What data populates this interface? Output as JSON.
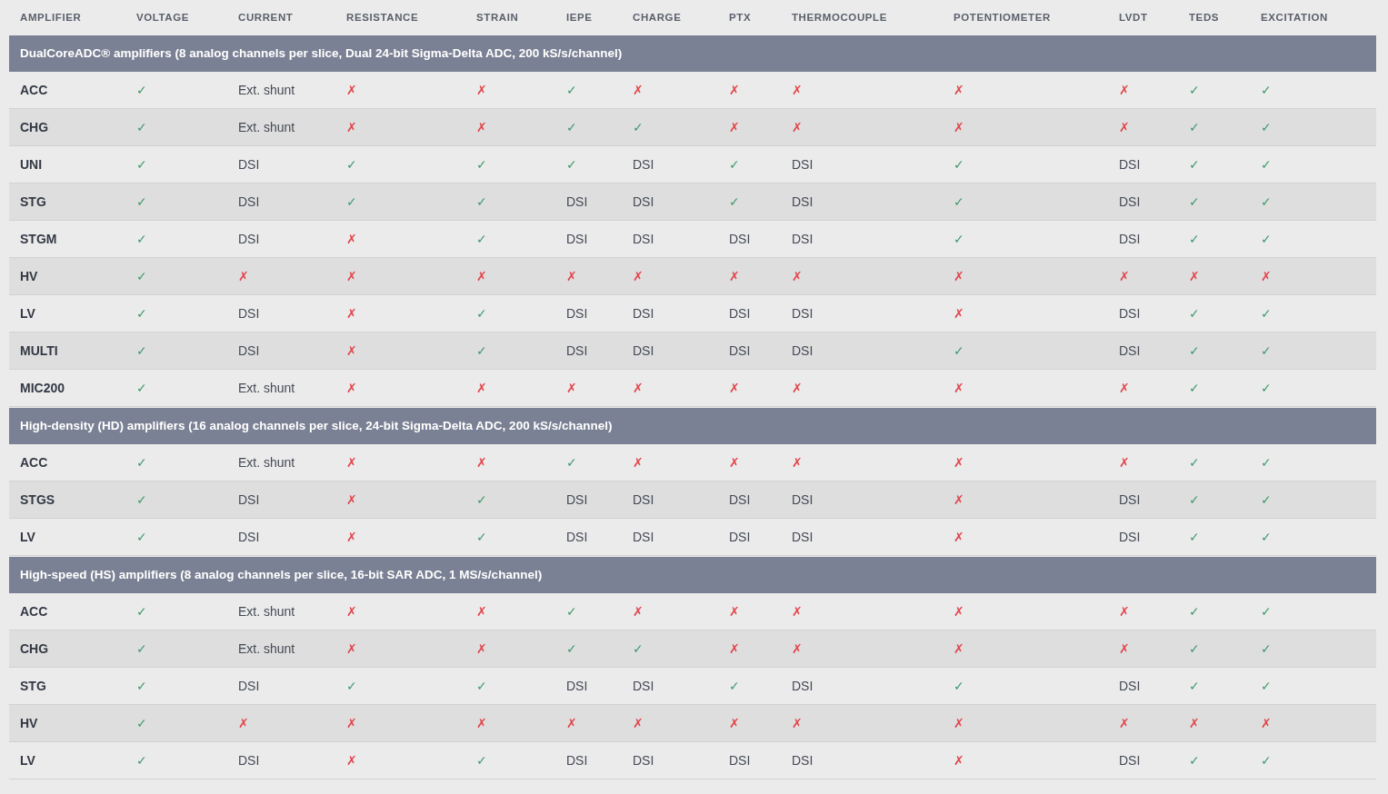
{
  "table": {
    "columns": [
      "AMPLIFIER",
      "VOLTAGE",
      "CURRENT",
      "RESISTANCE",
      "STRAIN",
      "IEPE",
      "CHARGE",
      "PTX",
      "THERMOCOUPLE",
      "POTENTIOMETER",
      "LVDT",
      "TEDS",
      "EXCITATION"
    ],
    "groups": [
      {
        "title": "DualCoreADC® amplifiers (8 analog channels per slice, Dual 24-bit Sigma-Delta ADC, 200 kS/s/channel)",
        "rows": [
          {
            "amplifier": "ACC",
            "cells": [
              {
                "text": "✓",
                "kind": "yes"
              },
              {
                "text": "Ext. shunt",
                "kind": "text"
              },
              {
                "text": "✗",
                "kind": "no"
              },
              {
                "text": "✗",
                "kind": "no"
              },
              {
                "text": "✓",
                "kind": "yes"
              },
              {
                "text": "✗",
                "kind": "no"
              },
              {
                "text": "✗",
                "kind": "no"
              },
              {
                "text": "✗",
                "kind": "no"
              },
              {
                "text": "✗",
                "kind": "no"
              },
              {
                "text": "✗",
                "kind": "no"
              },
              {
                "text": "✓",
                "kind": "yes"
              },
              {
                "text": "✓",
                "kind": "yes"
              }
            ]
          },
          {
            "amplifier": "CHG",
            "cells": [
              {
                "text": "✓",
                "kind": "yes"
              },
              {
                "text": "Ext. shunt",
                "kind": "text"
              },
              {
                "text": "✗",
                "kind": "no"
              },
              {
                "text": "✗",
                "kind": "no"
              },
              {
                "text": "✓",
                "kind": "yes"
              },
              {
                "text": "✓",
                "kind": "yes"
              },
              {
                "text": "✗",
                "kind": "no"
              },
              {
                "text": "✗",
                "kind": "no"
              },
              {
                "text": "✗",
                "kind": "no"
              },
              {
                "text": "✗",
                "kind": "no"
              },
              {
                "text": "✓",
                "kind": "yes"
              },
              {
                "text": "✓",
                "kind": "yes"
              }
            ]
          },
          {
            "amplifier": "UNI",
            "cells": [
              {
                "text": "✓",
                "kind": "yes"
              },
              {
                "text": "DSI",
                "kind": "text"
              },
              {
                "text": "✓",
                "kind": "yes"
              },
              {
                "text": "✓",
                "kind": "yes"
              },
              {
                "text": "✓",
                "kind": "yes"
              },
              {
                "text": "DSI",
                "kind": "text"
              },
              {
                "text": "✓",
                "kind": "yes"
              },
              {
                "text": "DSI",
                "kind": "text"
              },
              {
                "text": "✓",
                "kind": "yes"
              },
              {
                "text": "DSI",
                "kind": "text"
              },
              {
                "text": "✓",
                "kind": "yes"
              },
              {
                "text": "✓",
                "kind": "yes"
              }
            ]
          },
          {
            "amplifier": "STG",
            "cells": [
              {
                "text": "✓",
                "kind": "yes"
              },
              {
                "text": "DSI",
                "kind": "text"
              },
              {
                "text": "✓",
                "kind": "yes"
              },
              {
                "text": "✓",
                "kind": "yes"
              },
              {
                "text": "DSI",
                "kind": "text"
              },
              {
                "text": "DSI",
                "kind": "text"
              },
              {
                "text": "✓",
                "kind": "yes"
              },
              {
                "text": "DSI",
                "kind": "text"
              },
              {
                "text": "✓",
                "kind": "yes"
              },
              {
                "text": "DSI",
                "kind": "text"
              },
              {
                "text": "✓",
                "kind": "yes"
              },
              {
                "text": "✓",
                "kind": "yes"
              }
            ]
          },
          {
            "amplifier": "STGM",
            "cells": [
              {
                "text": "✓",
                "kind": "yes"
              },
              {
                "text": "DSI",
                "kind": "text"
              },
              {
                "text": "✗",
                "kind": "no"
              },
              {
                "text": "✓",
                "kind": "yes"
              },
              {
                "text": "DSI",
                "kind": "text"
              },
              {
                "text": "DSI",
                "kind": "text"
              },
              {
                "text": "DSI",
                "kind": "text"
              },
              {
                "text": "DSI",
                "kind": "text"
              },
              {
                "text": "✓",
                "kind": "yes"
              },
              {
                "text": "DSI",
                "kind": "text"
              },
              {
                "text": "✓",
                "kind": "yes"
              },
              {
                "text": "✓",
                "kind": "yes"
              }
            ]
          },
          {
            "amplifier": "HV",
            "cells": [
              {
                "text": "✓",
                "kind": "yes"
              },
              {
                "text": "✗",
                "kind": "no"
              },
              {
                "text": "✗",
                "kind": "no"
              },
              {
                "text": "✗",
                "kind": "no"
              },
              {
                "text": "✗",
                "kind": "no"
              },
              {
                "text": "✗",
                "kind": "no"
              },
              {
                "text": "✗",
                "kind": "no"
              },
              {
                "text": "✗",
                "kind": "no"
              },
              {
                "text": "✗",
                "kind": "no"
              },
              {
                "text": "✗",
                "kind": "no"
              },
              {
                "text": "✗",
                "kind": "no"
              },
              {
                "text": "✗",
                "kind": "no"
              }
            ]
          },
          {
            "amplifier": "LV",
            "cells": [
              {
                "text": "✓",
                "kind": "yes"
              },
              {
                "text": "DSI",
                "kind": "text"
              },
              {
                "text": "✗",
                "kind": "no"
              },
              {
                "text": "✓",
                "kind": "yes"
              },
              {
                "text": "DSI",
                "kind": "text"
              },
              {
                "text": "DSI",
                "kind": "text"
              },
              {
                "text": "DSI",
                "kind": "text"
              },
              {
                "text": "DSI",
                "kind": "text"
              },
              {
                "text": "✗",
                "kind": "no"
              },
              {
                "text": "DSI",
                "kind": "text"
              },
              {
                "text": "✓",
                "kind": "yes"
              },
              {
                "text": "✓",
                "kind": "yes"
              }
            ]
          },
          {
            "amplifier": "MULTI",
            "cells": [
              {
                "text": "✓",
                "kind": "yes"
              },
              {
                "text": "DSI",
                "kind": "text"
              },
              {
                "text": "✗",
                "kind": "no"
              },
              {
                "text": "✓",
                "kind": "yes"
              },
              {
                "text": "DSI",
                "kind": "text"
              },
              {
                "text": "DSI",
                "kind": "text"
              },
              {
                "text": "DSI",
                "kind": "text"
              },
              {
                "text": "DSI",
                "kind": "text"
              },
              {
                "text": "✓",
                "kind": "yes"
              },
              {
                "text": "DSI",
                "kind": "text"
              },
              {
                "text": "✓",
                "kind": "yes"
              },
              {
                "text": "✓",
                "kind": "yes"
              }
            ]
          },
          {
            "amplifier": "MIC200",
            "cells": [
              {
                "text": "✓",
                "kind": "yes"
              },
              {
                "text": "Ext. shunt",
                "kind": "text"
              },
              {
                "text": "✗",
                "kind": "no"
              },
              {
                "text": "✗",
                "kind": "no"
              },
              {
                "text": "✗",
                "kind": "no"
              },
              {
                "text": "✗",
                "kind": "no"
              },
              {
                "text": "✗",
                "kind": "no"
              },
              {
                "text": "✗",
                "kind": "no"
              },
              {
                "text": "✗",
                "kind": "no"
              },
              {
                "text": "✗",
                "kind": "no"
              },
              {
                "text": "✓",
                "kind": "yes"
              },
              {
                "text": "✓",
                "kind": "yes"
              }
            ]
          }
        ]
      },
      {
        "title": "High-density (HD) amplifiers (16 analog channels per slice, 24-bit Sigma-Delta ADC, 200 kS/s/channel)",
        "rows": [
          {
            "amplifier": "ACC",
            "cells": [
              {
                "text": "✓",
                "kind": "yes"
              },
              {
                "text": "Ext. shunt",
                "kind": "text"
              },
              {
                "text": "✗",
                "kind": "no"
              },
              {
                "text": "✗",
                "kind": "no"
              },
              {
                "text": "✓",
                "kind": "yes"
              },
              {
                "text": "✗",
                "kind": "no"
              },
              {
                "text": "✗",
                "kind": "no"
              },
              {
                "text": "✗",
                "kind": "no"
              },
              {
                "text": "✗",
                "kind": "no"
              },
              {
                "text": "✗",
                "kind": "no"
              },
              {
                "text": "✓",
                "kind": "yes"
              },
              {
                "text": "✓",
                "kind": "yes"
              }
            ]
          },
          {
            "amplifier": "STGS",
            "cells": [
              {
                "text": "✓",
                "kind": "yes"
              },
              {
                "text": "DSI",
                "kind": "text"
              },
              {
                "text": "✗",
                "kind": "no"
              },
              {
                "text": "✓",
                "kind": "yes"
              },
              {
                "text": "DSI",
                "kind": "text"
              },
              {
                "text": "DSI",
                "kind": "text"
              },
              {
                "text": "DSI",
                "kind": "text"
              },
              {
                "text": "DSI",
                "kind": "text"
              },
              {
                "text": "✗",
                "kind": "no"
              },
              {
                "text": "DSI",
                "kind": "text"
              },
              {
                "text": "✓",
                "kind": "yes"
              },
              {
                "text": "✓",
                "kind": "yes"
              }
            ]
          },
          {
            "amplifier": "LV",
            "cells": [
              {
                "text": "✓",
                "kind": "yes"
              },
              {
                "text": "DSI",
                "kind": "text"
              },
              {
                "text": "✗",
                "kind": "no"
              },
              {
                "text": "✓",
                "kind": "yes"
              },
              {
                "text": "DSI",
                "kind": "text"
              },
              {
                "text": "DSI",
                "kind": "text"
              },
              {
                "text": "DSI",
                "kind": "text"
              },
              {
                "text": "DSI",
                "kind": "text"
              },
              {
                "text": "✗",
                "kind": "no"
              },
              {
                "text": "DSI",
                "kind": "text"
              },
              {
                "text": "✓",
                "kind": "yes"
              },
              {
                "text": "✓",
                "kind": "yes"
              }
            ]
          }
        ]
      },
      {
        "title": "High-speed (HS) amplifiers (8 analog channels per slice, 16-bit SAR ADC, 1 MS/s/channel)",
        "rows": [
          {
            "amplifier": "ACC",
            "cells": [
              {
                "text": "✓",
                "kind": "yes"
              },
              {
                "text": "Ext. shunt",
                "kind": "text"
              },
              {
                "text": "✗",
                "kind": "no"
              },
              {
                "text": "✗",
                "kind": "no"
              },
              {
                "text": "✓",
                "kind": "yes"
              },
              {
                "text": "✗",
                "kind": "no"
              },
              {
                "text": "✗",
                "kind": "no"
              },
              {
                "text": "✗",
                "kind": "no"
              },
              {
                "text": "✗",
                "kind": "no"
              },
              {
                "text": "✗",
                "kind": "no"
              },
              {
                "text": "✓",
                "kind": "yes"
              },
              {
                "text": "✓",
                "kind": "yes"
              }
            ]
          },
          {
            "amplifier": "CHG",
            "cells": [
              {
                "text": "✓",
                "kind": "yes"
              },
              {
                "text": "Ext. shunt",
                "kind": "text"
              },
              {
                "text": "✗",
                "kind": "no"
              },
              {
                "text": "✗",
                "kind": "no"
              },
              {
                "text": "✓",
                "kind": "yes"
              },
              {
                "text": "✓",
                "kind": "yes"
              },
              {
                "text": "✗",
                "kind": "no"
              },
              {
                "text": "✗",
                "kind": "no"
              },
              {
                "text": "✗",
                "kind": "no"
              },
              {
                "text": "✗",
                "kind": "no"
              },
              {
                "text": "✓",
                "kind": "yes"
              },
              {
                "text": "✓",
                "kind": "yes"
              }
            ]
          },
          {
            "amplifier": "STG",
            "cells": [
              {
                "text": "✓",
                "kind": "yes"
              },
              {
                "text": "DSI",
                "kind": "text"
              },
              {
                "text": "✓",
                "kind": "yes"
              },
              {
                "text": "✓",
                "kind": "yes"
              },
              {
                "text": "DSI",
                "kind": "text"
              },
              {
                "text": "DSI",
                "kind": "text"
              },
              {
                "text": "✓",
                "kind": "yes"
              },
              {
                "text": "DSI",
                "kind": "text"
              },
              {
                "text": "✓",
                "kind": "yes"
              },
              {
                "text": "DSI",
                "kind": "text"
              },
              {
                "text": "✓",
                "kind": "yes"
              },
              {
                "text": "✓",
                "kind": "yes"
              }
            ]
          },
          {
            "amplifier": "HV",
            "cells": [
              {
                "text": "✓",
                "kind": "yes"
              },
              {
                "text": "✗",
                "kind": "no"
              },
              {
                "text": "✗",
                "kind": "no"
              },
              {
                "text": "✗",
                "kind": "no"
              },
              {
                "text": "✗",
                "kind": "no"
              },
              {
                "text": "✗",
                "kind": "no"
              },
              {
                "text": "✗",
                "kind": "no"
              },
              {
                "text": "✗",
                "kind": "no"
              },
              {
                "text": "✗",
                "kind": "no"
              },
              {
                "text": "✗",
                "kind": "no"
              },
              {
                "text": "✗",
                "kind": "no"
              },
              {
                "text": "✗",
                "kind": "no"
              }
            ]
          },
          {
            "amplifier": "LV",
            "cells": [
              {
                "text": "✓",
                "kind": "yes"
              },
              {
                "text": "DSI",
                "kind": "text"
              },
              {
                "text": "✗",
                "kind": "no"
              },
              {
                "text": "✓",
                "kind": "yes"
              },
              {
                "text": "DSI",
                "kind": "text"
              },
              {
                "text": "DSI",
                "kind": "text"
              },
              {
                "text": "DSI",
                "kind": "text"
              },
              {
                "text": "DSI",
                "kind": "text"
              },
              {
                "text": "✗",
                "kind": "no"
              },
              {
                "text": "DSI",
                "kind": "text"
              },
              {
                "text": "✓",
                "kind": "yes"
              },
              {
                "text": "✓",
                "kind": "yes"
              }
            ]
          }
        ]
      }
    ]
  }
}
